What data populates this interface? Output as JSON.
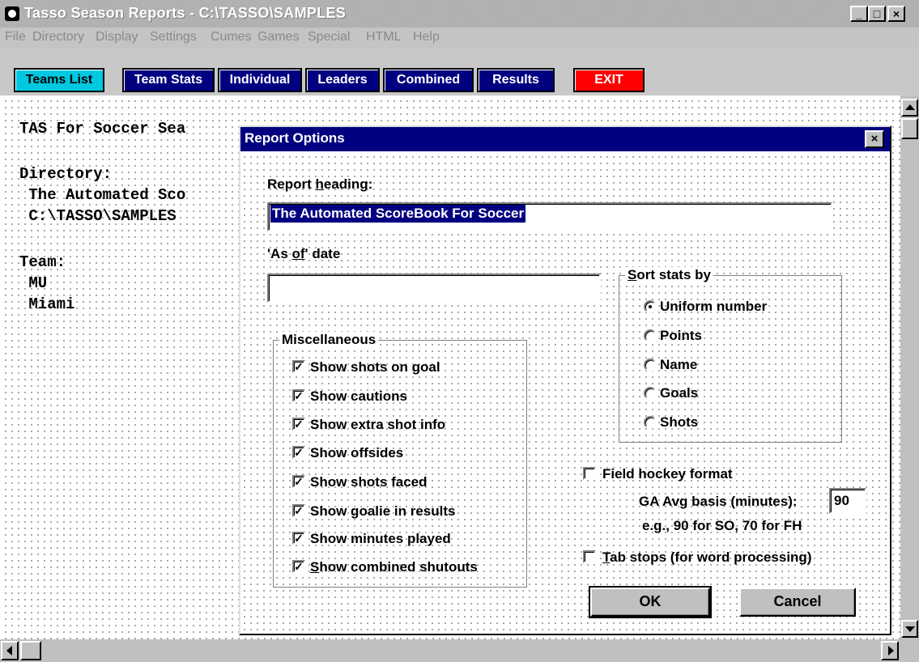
{
  "window": {
    "title": "Tasso Season Reports - C:\\TASSO\\SAMPLES",
    "min_label": "_",
    "max_label": "□",
    "close_label": "×"
  },
  "menu": [
    "File",
    "Directory",
    "Display",
    "Settings",
    "Cumes",
    "Games",
    "Special",
    "HTML",
    "Help"
  ],
  "toolbar": {
    "teams_list": "Teams List",
    "team_stats": "Team Stats",
    "individual": "Individual",
    "leaders": "Leaders",
    "combined": "Combined",
    "results": "Results",
    "exit": "EXIT"
  },
  "document": {
    "line1": "TAS For Soccer Sea",
    "directory_label": "Directory:",
    "directory_line1": " The Automated Sco",
    "directory_line2": " C:\\TASSO\\SAMPLES",
    "team_label": "Team:",
    "team1": " MU",
    "team2": " Miami"
  },
  "dialog": {
    "title": "Report Options",
    "close_label": "×",
    "report_heading_label_pre": "Report ",
    "report_heading_label_ul": "h",
    "report_heading_label_post": "eading:",
    "report_heading_value": "The Automated ScoreBook For Soccer",
    "as_of_label_pre": "'As ",
    "as_of_label_ul": "of",
    "as_of_label_post": "' date",
    "as_of_value": "",
    "sort": {
      "title_ul": "S",
      "title_post": "ort stats by",
      "options": [
        "Uniform number",
        "Points",
        "Name",
        "Goals",
        "Shots"
      ],
      "selected": "Uniform number"
    },
    "misc": {
      "title": "Miscellaneous",
      "items": [
        {
          "label": "Show shots on goal",
          "checked": true
        },
        {
          "label": "Show cautions",
          "checked": true
        },
        {
          "label": "Show extra shot info",
          "checked": true
        },
        {
          "label": "Show offsides",
          "checked": true
        },
        {
          "label": "Show shots faced",
          "checked": true
        },
        {
          "label": "Show goalie in results",
          "checked": true
        },
        {
          "label": "Show minutes played",
          "checked": true
        },
        {
          "label": "Show combined shutouts",
          "checked": true
        }
      ],
      "last_item_ul": "S",
      "last_item_post": "how combined shutouts"
    },
    "field_hockey": {
      "label": "Field hockey format",
      "checked": false
    },
    "ga_avg_label": "GA Avg basis (minutes):",
    "ga_avg_value": "90",
    "ga_example": "e.g., 90 for SO, 70 for FH",
    "tab_stops": {
      "label_ul": "T",
      "label_post": "ab stops (for word processing)",
      "checked": false
    },
    "ok_label": "OK",
    "cancel_label": "Cancel"
  },
  "colors": {
    "dialog_title_bg": "#000080",
    "toolbar_button_bg": "#000080",
    "active_button_bg": "#00c8e0",
    "exit_button_bg": "#ff0000"
  }
}
